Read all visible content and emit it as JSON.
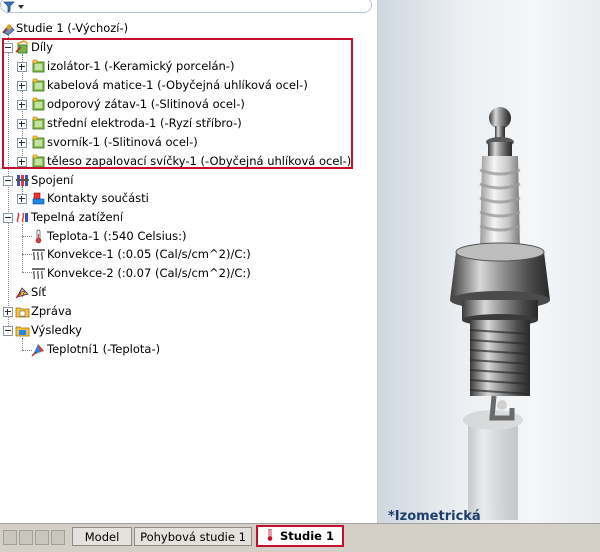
{
  "tree": {
    "root": "Studie 1 (-Výchozí-)",
    "parts": {
      "label": "Díly",
      "items": [
        "izolátor-1 (-Keramický porcelán-)",
        "kabelová matice-1 (-Obyčejná uhlíková ocel-)",
        "odporový zátav-1 (-Slitinová ocel-)",
        "střední elektroda-1 (-Ryzí stříbro-)",
        "svorník-1 (-Slitinová ocel-)",
        "těleso zapalovací svíčky-1 (-Obyčejná uhlíková ocel-)"
      ]
    },
    "connections": {
      "label": "Spojení",
      "child": "Kontakty součásti"
    },
    "thermal": {
      "label": "Tepelná zatížení",
      "items": [
        "Teplota-1 (:540 Celsius:)",
        "Konvekce-1 (:0.05 (Cal/s/cm^2)/C:)",
        "Konvekce-2 (:0.07 (Cal/s/cm^2)/C:)"
      ]
    },
    "mesh": "Síť",
    "report": "Zpráva",
    "results": {
      "label": "Výsledky",
      "child": "Teplotní1 (-Teplota-)"
    }
  },
  "viewport": {
    "view_label": "*Izometrická"
  },
  "tabs": [
    "Model",
    "Pohybová studie 1",
    "Studie 1"
  ],
  "active_tab": "Studie 1",
  "colors": {
    "highlight": "#c8102e",
    "view_label": "#1d3d6a"
  }
}
